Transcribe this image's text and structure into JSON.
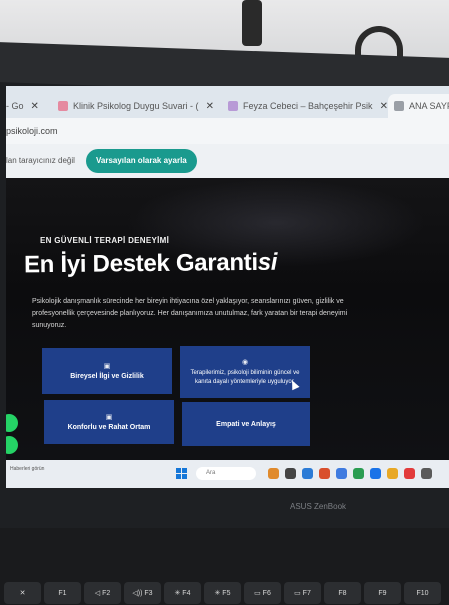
{
  "browser": {
    "tabs": [
      {
        "label": "- Go",
        "close": "✕",
        "icon_color": "#e5a3a3"
      },
      {
        "label": "Klinik Psikolog Duygu Suvari - (",
        "close": "✕",
        "icon_color": "#e58aa0"
      },
      {
        "label": "Feyza Cebeci – Bahçeşehir Psik",
        "close": "✕",
        "icon_color": "#b89ad6"
      },
      {
        "label": "ANA SAYFA",
        "close": "",
        "icon_color": "#9a9fa6"
      }
    ],
    "url": "psikoloji.com",
    "infobar": {
      "message": "lan tarayıcınız değil",
      "button": "Varsayılan olarak ayarla"
    }
  },
  "hero": {
    "eyebrow": "EN GÜVENLİ TERAPİ DENEYİMİ",
    "title_main": "En İyi Destek Garanti",
    "title_accent": "si",
    "paragraph": "Psikolojik danışmanlık sürecinde her bireyin ihtiyacına özel yaklaşıyor, seanslarınızı güven, gizlilik ve profesyonellik çerçevesinde planlıyoruz. Her danışanımıza unutulmaz, fark yaratan bir terapi deneyimi sunuyoruz."
  },
  "cards": [
    {
      "icon": "▣",
      "title": "Bireysel İlgi ve Gizlilik",
      "desc": ""
    },
    {
      "icon": "◉",
      "title": "",
      "desc": "Terapilerimiz, psikoloji biliminin güncel ve kanıta dayalı yöntemleriyle uyguluyor."
    },
    {
      "icon": "▣",
      "title": "Konforlu ve Rahat Ortam",
      "desc": ""
    },
    {
      "icon": "",
      "title": "Empati ve Anlayış",
      "desc": ""
    }
  ],
  "taskbar": {
    "weather": "Haberleri görün",
    "search_placeholder": "Ara",
    "app_colors": [
      "#e08a2c",
      "#444444",
      "#2b7bd6",
      "#d94f2c",
      "#3f7be0",
      "#2a9d52",
      "#1a73e8",
      "#e8a825",
      "#e23b3b",
      "#5a5a5a"
    ]
  },
  "laptop": {
    "brand": "ASUS ZenBook",
    "fkeys": [
      "✕",
      "F1",
      "◁ F2",
      "◁)) F3",
      "✳ F4",
      "✳ F5",
      "▭ F6",
      "▭ F7",
      "F8",
      "F9",
      "F10"
    ]
  }
}
